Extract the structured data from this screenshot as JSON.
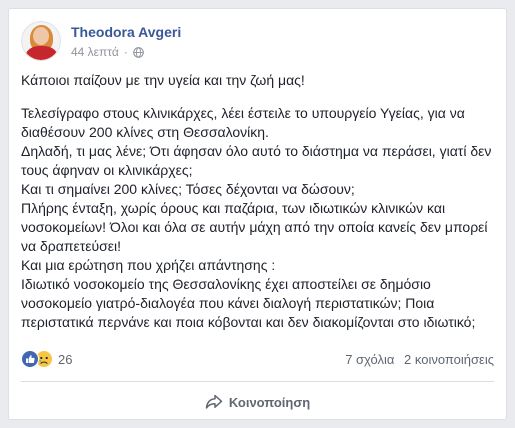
{
  "post": {
    "author": "Theodora Avgeri",
    "time": "44 λεπτά",
    "separator": "·",
    "paragraphs": [
      [
        "Κάποιοι παίζουν με την υγεία και την ζωή μας!"
      ],
      [
        "Τελεσίγραφο στους κλινικάρχες, λέει έστειλε το υπουργείο Υγείας, για να",
        "διαθέσουν 200 κλίνες στη Θεσσαλονίκη.",
        "Δηλαδή, τι μας λένε; Ότι άφησαν όλο αυτό το διάστημα να περάσει, γιατί δεν",
        "τους άφηναν οι κλινικάρχες;",
        "Και τι σημαίνει 200 κλίνες; Τόσες δέχονται να δώσουν;",
        "Πλήρης ένταξη, χωρίς όρους και παζάρια, των ιδιωτικών κλινικών και",
        "νοσοκομείων! Όλοι και όλα σε αυτήν μάχη από την οποία κανείς δεν μπορεί",
        "να δραπετεύσει!",
        "Και μια ερώτηση που χρήζει απάντησης :",
        "Ιδιωτικό νοσοκομείο της Θεσσαλονίκης έχει αποστείλει σε δημόσιο",
        "νοσοκομείο γιατρό-διαλογέα που κάνει διαλογή περιστατικών; Ποια",
        "περιστατικά περνάνε και ποια κόβονται και δεν διακομίζονται στο ιδιωτικό;"
      ]
    ]
  },
  "stats": {
    "reaction_count": "26",
    "comments": "7 σχόλια",
    "shares": "2 κοινοποιήσεις"
  },
  "actions": {
    "share_label": "Κοινοποίηση"
  },
  "colors": {
    "author_link": "#385898",
    "like_blue": "#4267b2",
    "sad_yellow": "#f7c744"
  }
}
